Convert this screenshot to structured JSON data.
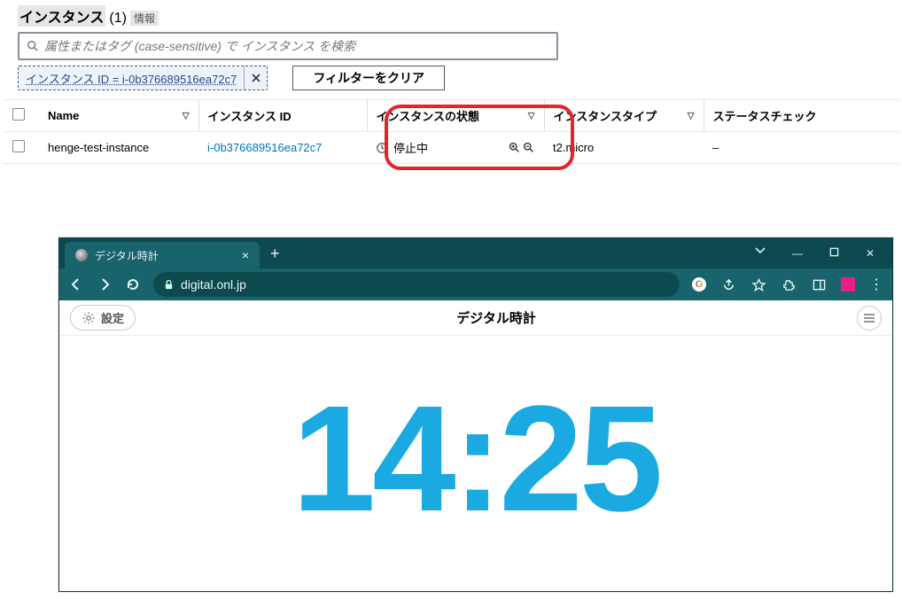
{
  "aws": {
    "title": "インスタンス",
    "count": "(1)",
    "info": "情報",
    "search_placeholder": "属性またはタグ (case-sensitive) で インスタンス を検索",
    "filter_chip": "インスタンス ID = i-0b376689516ea72c7",
    "clear_filters_label": "フィルターをクリア",
    "columns": {
      "name": "Name",
      "instance_id": "インスタンス ID",
      "state": "インスタンスの状態",
      "type": "インスタンスタイプ",
      "status_check": "ステータスチェック"
    },
    "rows": [
      {
        "name": "henge-test-instance",
        "instance_id": "i-0b376689516ea72c7",
        "state": "停止中",
        "type": "t2.micro",
        "status_check": "–"
      }
    ]
  },
  "browser": {
    "tab_title": "デジタル時計",
    "url": "digital.onl.jp",
    "page": {
      "settings_label": "設定",
      "title": "デジタル時計",
      "clock": "14:25"
    }
  }
}
